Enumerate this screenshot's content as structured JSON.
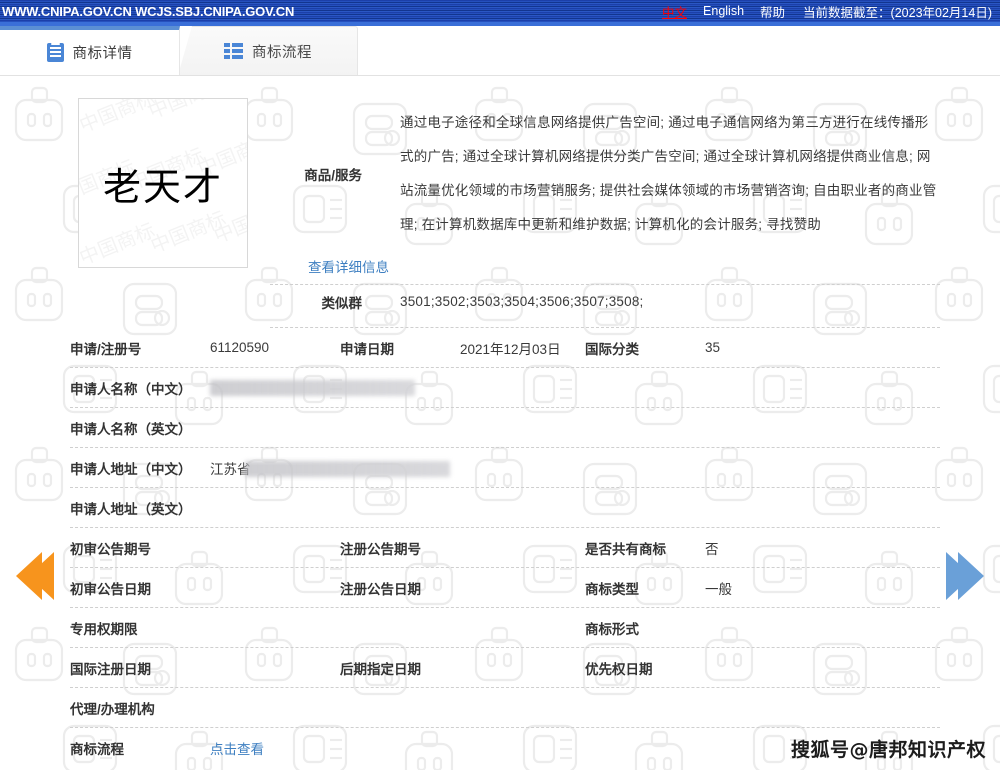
{
  "topbar": {
    "urls": "WWW.CNIPA.GOV.CN WCJS.SBJ.CNIPA.GOV.CN",
    "lang_cn": "中文",
    "lang_en": "English",
    "help": "帮助",
    "data_cutoff": "当前数据截至：(2023年02月14日)"
  },
  "tabs": [
    {
      "label": "商标详情",
      "icon": "document-icon",
      "active": true
    },
    {
      "label": "商标流程",
      "icon": "list-icon",
      "active": false
    }
  ],
  "trademark": {
    "image_text": "老天才",
    "image_watermark": "中国商标"
  },
  "goods": {
    "label": "商品/服务",
    "text": "通过电子途径和全球信息网络提供广告空间; 通过电子通信网络为第三方进行在线传播形式的广告; 通过全球计算机网络提供分类广告空间; 通过全球计算机网络提供商业信息; 网站流量优化领域的市场营销服务; 提供社会媒体领域的市场营销咨询; 自由职业者的商业管理; 在计算机数据库中更新和维护数据; 计算机化的会计服务; 寻找赞助",
    "detail_link": "查看详细信息",
    "similar_group_label": "类似群",
    "similar_group_value": "3501;3502;3503;3504;3506;3507;3508;"
  },
  "fields": {
    "app_no_label": "申请/注册号",
    "app_no_value": "61120590",
    "app_date_label": "申请日期",
    "app_date_value": "2021年12月03日",
    "intl_class_label": "国际分类",
    "intl_class_value": "35",
    "applicant_cn_label": "申请人名称（中文）",
    "applicant_cn_value": "",
    "applicant_en_label": "申请人名称（英文）",
    "applicant_en_value": "",
    "address_cn_label": "申请人地址（中文）",
    "address_cn_value": "江苏省",
    "address_en_label": "申请人地址（英文）",
    "address_en_value": "",
    "prelim_no_label": "初审公告期号",
    "prelim_no_value": "",
    "reg_no_label": "注册公告期号",
    "reg_no_value": "",
    "shared_label": "是否共有商标",
    "shared_value": "否",
    "prelim_date_label": "初审公告日期",
    "prelim_date_value": "",
    "reg_date_label": "注册公告日期",
    "reg_date_value": "",
    "tm_type_label": "商标类型",
    "tm_type_value": "一般",
    "exclusive_label": "专用权期限",
    "exclusive_value": "",
    "tm_form_label": "商标形式",
    "tm_form_value": "",
    "intl_reg_date_label": "国际注册日期",
    "intl_reg_date_value": "",
    "later_designate_label": "后期指定日期",
    "later_designate_value": "",
    "priority_label": "优先权日期",
    "priority_value": "",
    "agent_label": "代理/办理机构",
    "agent_value": "",
    "process_label": "商标流程",
    "process_link": "点击查看"
  },
  "nav": {
    "prev_icon": "chevron-left-icon",
    "next_icon": "chevron-right-icon"
  },
  "footer": {
    "watermark": "搜狐号@唐邦知识产权"
  },
  "colors": {
    "header_blue": "#1c40ab",
    "accent_blue": "#4a86d6",
    "link_blue": "#3e7fc1",
    "alert_red": "#ff0000",
    "prev_arrow": "#f7941d",
    "next_arrow": "#6aa0d8"
  }
}
